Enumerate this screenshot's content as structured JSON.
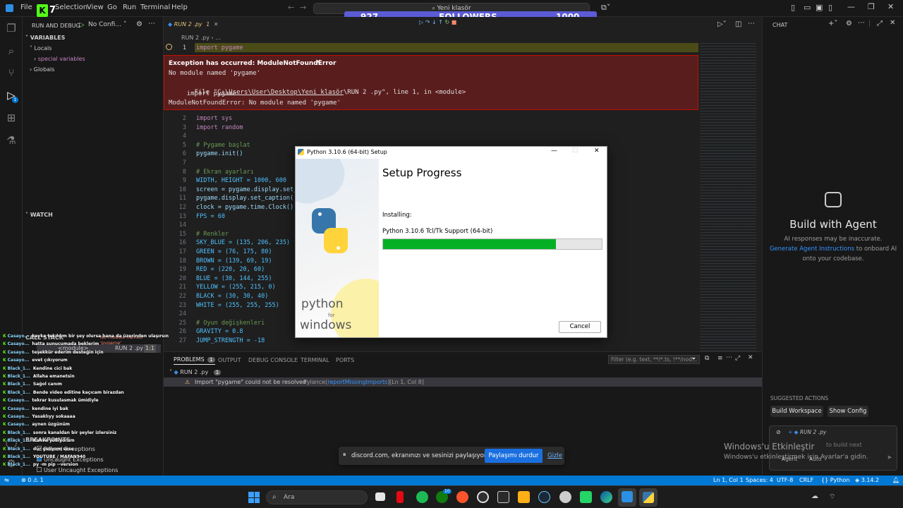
{
  "titlebar": {
    "menu": [
      "File",
      "Selection",
      "View",
      "Go",
      "Run",
      "Terminal",
      "Help"
    ],
    "search_text": "Yeni klasör",
    "overlay_logo_number": "7",
    "followers": {
      "current": "927",
      "label": "FOLLOWERS",
      "goal": "1000",
      "progress": 0.927
    }
  },
  "sidebar": {
    "run_debug_title": "RUN AND DEBUG",
    "config_label": "No Confi...",
    "variables_header": "VARIABLES",
    "locals": "Locals",
    "special_variables": "special variables",
    "globals": "Globals",
    "watch_header": "WATCH",
    "call_stack_header": "CALL STACK",
    "call_stack_badge": "No module named 'pygame'",
    "call_stack_item": "<module>",
    "call_stack_file": "RUN 2 .py",
    "call_stack_pos": "1:1",
    "breakpoints_header": "BREAKPOINTS",
    "breakpoints": [
      "Raised Exceptions",
      "Uncaught Exceptions",
      "User Uncaught Exceptions"
    ]
  },
  "editor": {
    "tab_label": "RUN 2 .py",
    "tab_badge": "1",
    "breadcrumb": "RUN 2 .py  ›  ...",
    "first_line": {
      "num": "1",
      "code": "import pygame"
    },
    "lines": [
      {
        "num": "2",
        "code": "import sys"
      },
      {
        "num": "3",
        "code": "import random"
      },
      {
        "num": "4",
        "code": ""
      },
      {
        "num": "5",
        "code": "# Pygame başlat"
      },
      {
        "num": "6",
        "code": "pygame.init()"
      },
      {
        "num": "7",
        "code": ""
      },
      {
        "num": "8",
        "code": "# Ekran ayarları"
      },
      {
        "num": "9",
        "code": "WIDTH, HEIGHT = 1000, 600"
      },
      {
        "num": "10",
        "code": "screen = pygame.display.set_"
      },
      {
        "num": "11",
        "code": "pygame.display.set_caption("
      },
      {
        "num": "12",
        "code": "clock = pygame.time.Clock()"
      },
      {
        "num": "13",
        "code": "FPS = 60"
      },
      {
        "num": "14",
        "code": ""
      },
      {
        "num": "15",
        "code": "# Renkler"
      },
      {
        "num": "16",
        "code": "SKY_BLUE = (135, 206, 235)"
      },
      {
        "num": "17",
        "code": "GREEN = (76, 175, 80)"
      },
      {
        "num": "18",
        "code": "BROWN = (139, 69, 19)"
      },
      {
        "num": "19",
        "code": "RED = (220, 20, 60)"
      },
      {
        "num": "20",
        "code": "BLUE = (30, 144, 255)"
      },
      {
        "num": "21",
        "code": "YELLOW = (255, 215, 0)"
      },
      {
        "num": "22",
        "code": "BLACK = (30, 30, 40)"
      },
      {
        "num": "23",
        "code": "WHITE = (255, 255, 255)"
      },
      {
        "num": "24",
        "code": ""
      },
      {
        "num": "25",
        "code": "# Oyun değişkenleri"
      },
      {
        "num": "26",
        "code": "GRAVITY = 0.8"
      },
      {
        "num": "27",
        "code": "JUMP_STRENGTH = -18"
      }
    ],
    "exception": {
      "title": "Exception has occurred: ModuleNotFoundError",
      "line1": "No module named 'pygame'",
      "file_prefix": "  File \"",
      "file_path": "C:\\Users\\User\\Desktop\\Yeni klasör",
      "file_suffix": "\\RUN 2 .py\", line 1, in <module>",
      "line3": "    import pygame",
      "line4": "ModuleNotFoundError: No module named 'pygame'"
    }
  },
  "setup": {
    "window_title": "Python 3.10.6 (64-bit) Setup",
    "heading": "Setup Progress",
    "installing_label": "Installing:",
    "component": "Python 3.10.6 Tcl/Tk Support (64-bit)",
    "progress": 0.79,
    "cancel_label": "Cancel",
    "brand_line1": "python",
    "brand_for": "for",
    "brand_line2": "windows"
  },
  "panel": {
    "tabs": [
      "PROBLEMS",
      "OUTPUT",
      "DEBUG CONSOLE",
      "TERMINAL",
      "PORTS"
    ],
    "problems_count": "1",
    "filter_placeholder": "Filter (e.g. text, **/*.ts, !**/nod...",
    "file_group": "RUN 2 .py",
    "file_count": "1",
    "problem_message": "Import \"pygame\" could not be resolved",
    "problem_source": "Pylance(",
    "problem_link": "reportMissingImports",
    "problem_close": ")",
    "problem_pos": "[Ln 1, Col 8]"
  },
  "chat": {
    "header": "CHAT",
    "title": "Build with Agent",
    "line1": "AI responses may be inaccurate.",
    "link": "Generate Agent Instructions",
    "line2_rest": "to onboard AI",
    "line3": "onto your codebase.",
    "suggested_header": "SUGGESTED ACTIONS",
    "btn1": "Build Workspace",
    "btn2": "Show Config",
    "attached_file": "RUN 2 .py",
    "input_placeholder": "to build next",
    "agent_label": "Agent",
    "auto_label": "Auto"
  },
  "watermark": {
    "line1": "Windows'u Etkinleştir",
    "line2": "Windows'u etkinleştirmek için Ayarlar'a gidin."
  },
  "discord": {
    "message": "discord.com, ekranınızı ve sesinizi paylaşıyor.",
    "stop_label": "Paylaşımı durdur",
    "hide_label": "Gizle"
  },
  "statusbar": {
    "errors": "0",
    "warnings": "1",
    "position": "Ln 1, Col 1",
    "spaces": "Spaces: 4",
    "encoding": "UTF-8",
    "eol": "CRLF",
    "language": "Python",
    "version": "3.14.2"
  },
  "taskbar": {
    "search_placeholder": "Ara",
    "badge": "10"
  },
  "chat_overlay": [
    {
      "user": "Casayo...",
      "msg": "kayka takıldım bir şey olursa bana da üzerinden ulaşırsın"
    },
    {
      "user": "Casayo...",
      "msg": "hatta sunucumada beklerim"
    },
    {
      "user": "Casayo...",
      "msg": "teşekkür ederim desteğin için"
    },
    {
      "user": "Casayo...",
      "msg": "evet çıkıyorum"
    },
    {
      "user": "Black_1...",
      "msg": "Kendine cici bak"
    },
    {
      "user": "Black_1...",
      "msg": "Allaha emanetsin"
    },
    {
      "user": "Black_1...",
      "msg": "Sağol canım"
    },
    {
      "user": "Black_1...",
      "msg": "Bende video editine kaçıcam birazdan"
    },
    {
      "user": "Casayo...",
      "msg": "tekrar kusulasmak ümidiyle"
    },
    {
      "user": "Casayo...",
      "msg": "kendine iyi bak"
    },
    {
      "user": "Casayo...",
      "msg": "Yasaklıyy sokaaaa"
    },
    {
      "user": "Casayo...",
      "msg": "aynen üzgünüm"
    },
    {
      "user": "Black_1...",
      "msg": "sonra kanaldan bir şeyler izlersiniz"
    },
    {
      "user": "Black_1...",
      "msg": "Kahve yolliyorum"
    },
    {
      "user": "Black_1...",
      "msg": "dur geliyom sese"
    },
    {
      "user": "Black_1...",
      "msg": "YOUTUBE / MAFAN940"
    },
    {
      "user": "Black_1...",
      "msg": "py -m pip --version"
    }
  ],
  "colors": {
    "accent": "#0078d4",
    "exception_bg": "#5a1d1d",
    "progress_green": "#06b025",
    "followers_bar": "#5b5bd6"
  }
}
